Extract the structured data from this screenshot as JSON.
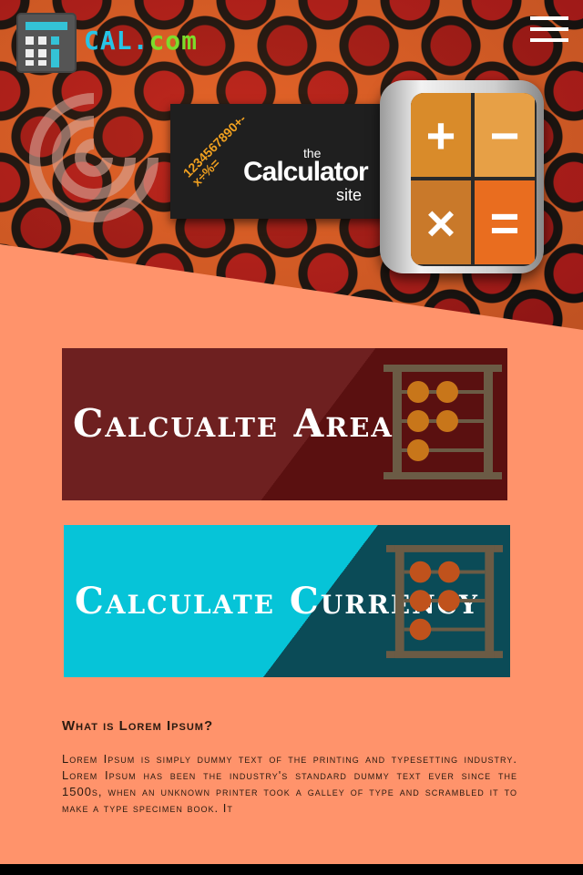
{
  "header": {
    "logo_prefix": "CAL.",
    "logo_suffix": "com",
    "menu_icon": "hamburger-menu-icon"
  },
  "hero": {
    "banner_numbers": "1234567890+-x÷%=",
    "banner_the": "the",
    "banner_main": "Calculator",
    "banner_site": "site",
    "device_keys": [
      "+",
      "−",
      "×",
      "="
    ]
  },
  "cards": [
    {
      "title": "Calcualte Area",
      "icon": "abacus-icon"
    },
    {
      "title": "Calculate Currency",
      "icon": "abacus-icon"
    }
  ],
  "article": {
    "heading": "What is Lorem Ipsum?",
    "body": "Lorem Ipsum is simply dummy text of the printing and typesetting industry. Lorem Ipsum has been the industry's standard dummy text ever since the 1500s, when an unknown printer took a galley of type and scrambled it to make a type specimen book. It"
  },
  "colors": {
    "background": "#FF936B",
    "card_area_dark": "#5a1414",
    "card_area_light": "#6e2020",
    "card_currency_teal": "#06c4d8",
    "card_currency_dark": "#0b4b57",
    "logo_blue": "#27c4e6",
    "logo_green": "#7ddc2b"
  }
}
